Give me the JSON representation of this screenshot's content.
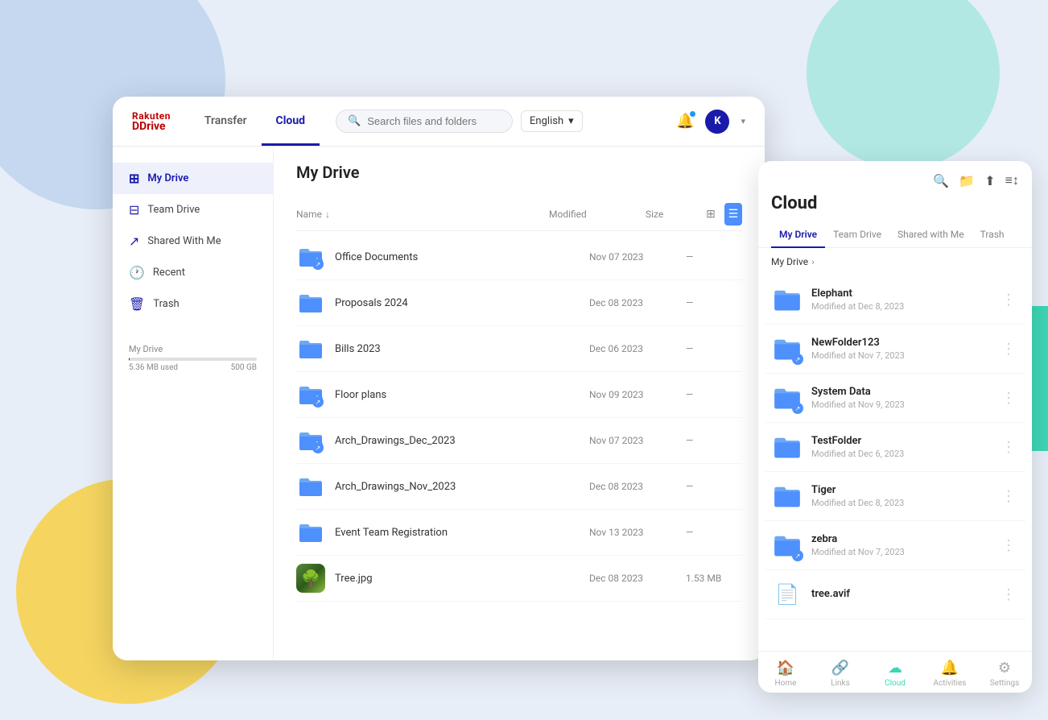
{
  "app": {
    "logo_rakuten": "Rakuten",
    "logo_drive": "Drive",
    "nav_tabs": [
      {
        "label": "Transfer",
        "active": false
      },
      {
        "label": "Cloud",
        "active": true
      }
    ]
  },
  "header": {
    "search_placeholder": "Search files and folders",
    "lang_label": "English",
    "bell_label": "Notifications",
    "avatar_label": "K"
  },
  "sidebar": {
    "items": [
      {
        "label": "My Drive",
        "icon": "grid",
        "active": true
      },
      {
        "label": "Team Drive",
        "icon": "team",
        "active": false
      },
      {
        "label": "Shared With Me",
        "icon": "share",
        "active": false
      },
      {
        "label": "Recent",
        "icon": "clock",
        "active": false
      },
      {
        "label": "Trash",
        "icon": "trash",
        "active": false
      }
    ],
    "storage_label": "My Drive",
    "storage_used": "5.36 MB used",
    "storage_total": "500 GB",
    "storage_pct": 0.2
  },
  "file_area": {
    "title": "My Drive",
    "col_name": "Name",
    "col_modified": "Modified",
    "col_size": "Size",
    "files": [
      {
        "name": "Office Documents",
        "modified": "Nov 07 2023",
        "size": "—",
        "type": "folder-shared"
      },
      {
        "name": "Proposals 2024",
        "modified": "Dec 08 2023",
        "size": "—",
        "type": "folder"
      },
      {
        "name": "Bills 2023",
        "modified": "Dec 06 2023",
        "size": "—",
        "type": "folder"
      },
      {
        "name": "Floor plans",
        "modified": "Nov 09 2023",
        "size": "—",
        "type": "folder-shared"
      },
      {
        "name": "Arch_Drawings_Dec_2023",
        "modified": "Nov 07 2023",
        "size": "—",
        "type": "folder-shared"
      },
      {
        "name": "Arch_Drawings_Nov_2023",
        "modified": "Dec 08 2023",
        "size": "—",
        "type": "folder"
      },
      {
        "name": "Event Team Registration",
        "modified": "Nov 13 2023",
        "size": "—",
        "type": "folder"
      },
      {
        "name": "Tree.jpg",
        "modified": "Dec 08 2023",
        "size": "1.53 MB",
        "type": "image"
      }
    ]
  },
  "cloud_panel": {
    "title": "Cloud",
    "tabs": [
      {
        "label": "My Drive",
        "active": true
      },
      {
        "label": "Team Drive",
        "active": false
      },
      {
        "label": "Shared with Me",
        "active": false
      },
      {
        "label": "Trash",
        "active": false
      }
    ],
    "breadcrumb": [
      "My Drive"
    ],
    "files": [
      {
        "name": "Elephant",
        "meta": "Modified at Dec 8, 2023",
        "type": "folder"
      },
      {
        "name": "NewFolder123",
        "meta": "Modified at Nov 7, 2023",
        "type": "folder-shared"
      },
      {
        "name": "System Data",
        "meta": "Modified at Nov 9, 2023",
        "type": "folder-shared"
      },
      {
        "name": "TestFolder",
        "meta": "Modified at Dec 6, 2023",
        "type": "folder"
      },
      {
        "name": "Tiger",
        "meta": "Modified at Dec 8, 2023",
        "type": "folder"
      },
      {
        "name": "zebra",
        "meta": "Modified at Nov 7, 2023",
        "type": "folder-shared"
      },
      {
        "name": "tree.avif",
        "meta": "",
        "type": "file"
      }
    ],
    "bottom_nav": [
      {
        "label": "Home",
        "icon": "home",
        "active": false
      },
      {
        "label": "Links",
        "icon": "links",
        "active": false
      },
      {
        "label": "Cloud",
        "icon": "cloud",
        "active": true
      },
      {
        "label": "Activities",
        "icon": "activities",
        "active": false
      },
      {
        "label": "Settings",
        "icon": "settings",
        "active": false
      }
    ]
  }
}
